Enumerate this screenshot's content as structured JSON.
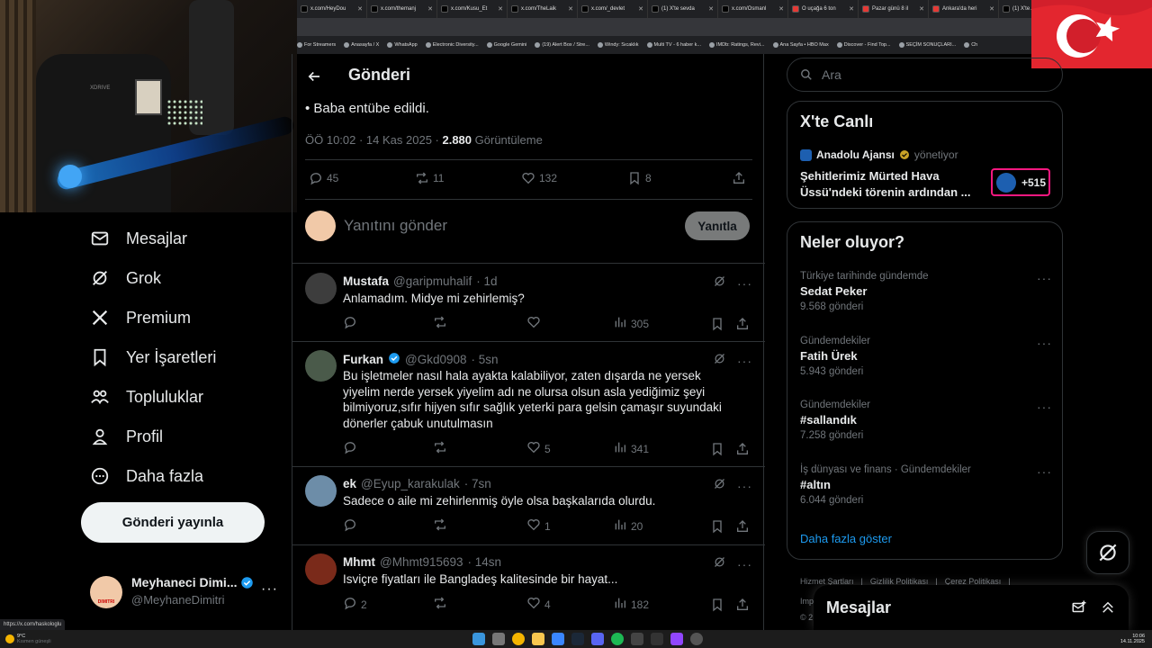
{
  "browser": {
    "tabs": [
      {
        "label": "x.com/HeyDou",
        "color": "#000"
      },
      {
        "label": "x.com/themanj",
        "color": "#000"
      },
      {
        "label": "x.com/Kusu_Et",
        "color": "#000"
      },
      {
        "label": "x.com/TheLaik",
        "color": "#000"
      },
      {
        "label": "x.com/_devlet",
        "color": "#000"
      },
      {
        "label": "(1) X'te sevda",
        "color": "#000"
      },
      {
        "label": "x.com/Osmanl",
        "color": "#000"
      },
      {
        "label": "O uçağa 6 ton",
        "color": "#e53935"
      },
      {
        "label": "Pazar günü 8 il",
        "color": "#e53935"
      },
      {
        "label": "Ankara'da heri",
        "color": "#e53935"
      },
      {
        "label": "(1) X'te Azad",
        "color": "#000"
      }
    ],
    "bookmarks": [
      "For Streamers",
      "Anasayfa / X",
      "WhatsApp",
      "Electronic Diversity...",
      "Google Gemini",
      "(19) Alert Box / Stre...",
      "Windy: Sıcaklık",
      "Multi TV - 6 haber k...",
      "IMDb: Ratings, Revi...",
      "Ana Sayfa • HBO Max",
      "Discover - Find Top...",
      "SEÇİM SONUÇLARI...",
      "Ch"
    ],
    "status_url": "https://x.com/haskologlu"
  },
  "nav": {
    "items": [
      {
        "label": "Mesajlar",
        "icon": "mail-icon"
      },
      {
        "label": "Grok",
        "icon": "grok-icon"
      },
      {
        "label": "Premium",
        "icon": "x-logo-icon"
      },
      {
        "label": "Yer İşaretleri",
        "icon": "bookmark-icon"
      },
      {
        "label": "Topluluklar",
        "icon": "communities-icon"
      },
      {
        "label": "Profil",
        "icon": "profile-icon"
      },
      {
        "label": "Daha fazla",
        "icon": "more-circle-icon"
      }
    ],
    "post_button": "Gönderi yayınla",
    "account": {
      "name": "Meyhaneci Dimi...",
      "handle": "@MeyhaneDimitri",
      "avatar_text": "DIMITRI"
    }
  },
  "post": {
    "header_title": "Gönderi",
    "text": "• Baba entübe edildi.",
    "time": "ÖÖ 10:02 · 14 Kas 2025 · ",
    "views": "2.880",
    "views_label": " Görüntüleme",
    "stats": {
      "replies": "45",
      "reposts": "11",
      "likes": "132",
      "bookmarks": "8"
    },
    "reply_placeholder": "Yanıtını gönder",
    "reply_button": "Yanıtla"
  },
  "replies": [
    {
      "name": "Mustafa",
      "verified": false,
      "handle": "@garipmuhalif",
      "time": "· 1d",
      "text": "Anlamadım. Midye mi zehirlemiş?",
      "replies": "",
      "reposts": "",
      "likes": "",
      "views": "305"
    },
    {
      "name": "Furkan",
      "verified": true,
      "handle": "@Gkd0908",
      "time": "· 5sn",
      "text": "Bu işletmeler nasıl hala ayakta kalabiliyor, zaten dışarda ne yersek yiyelim nerde yersek yiyelim adı ne olursa olsun asla yediğimiz şeyi bilmiyoruz,sıfır hijyen sıfır sağlık yeterki para gelsin çamaşır suyundaki dönerler çabuk unutulmasın",
      "replies": "",
      "reposts": "",
      "likes": "5",
      "views": "341"
    },
    {
      "name": "ek",
      "verified": false,
      "handle": "@Eyup_karakulak",
      "time": "· 7sn",
      "text": "Sadece o aile mi zehirlenmiş öyle olsa başkalarıda olurdu.",
      "replies": "",
      "reposts": "",
      "likes": "1",
      "views": "20"
    },
    {
      "name": "Mhmt",
      "verified": false,
      "handle": "@Mhmt915693",
      "time": "· 14sn",
      "text": "Isviçre fiyatları ile Bangladeş kalitesinde bir hayat...",
      "replies": "2",
      "reposts": "",
      "likes": "4",
      "views": "182"
    }
  ],
  "right": {
    "search_placeholder": "Ara",
    "live": {
      "title": "X'te Canlı",
      "source": "Anadolu Ajansı",
      "role": "yönetiyor",
      "headline": "Şehitlerimiz Mürted Hava Üssü'ndeki törenin ardından ...",
      "listeners": "+515"
    },
    "trends_title": "Neler oluyor?",
    "trends": [
      {
        "meta": "Türkiye tarihinde gündemde",
        "name": "Sedat Peker",
        "count": "9.568 gönderi"
      },
      {
        "meta": "Gündemdekiler",
        "name": "Fatih Ürek",
        "count": "5.943 gönderi"
      },
      {
        "meta": "Gündemdekiler",
        "name": "#sallandık",
        "count": "7.258 gönderi"
      },
      {
        "meta": "İş dünyası ve finans · Gündemdekiler",
        "name": "#altın",
        "count": "6.044 gönderi"
      }
    ],
    "show_more": "Daha fazla göster",
    "footer": [
      "Hizmet Şartları",
      "Gizlilik Politikası",
      "Çerez Politikası"
    ],
    "footer_partial": [
      "Imp",
      "© 2"
    ],
    "messages_drawer": "Mesajlar"
  },
  "taskbar": {
    "weather_temp": "9°C",
    "weather_desc": "Kısmen güneşli",
    "clock_time": "10:06",
    "clock_date": "14.11.2025"
  },
  "colors": {
    "accent": "#1d9bf0",
    "link": "#1d9bf0",
    "live_border": "#f91880",
    "flag_red": "#d21f2b"
  }
}
